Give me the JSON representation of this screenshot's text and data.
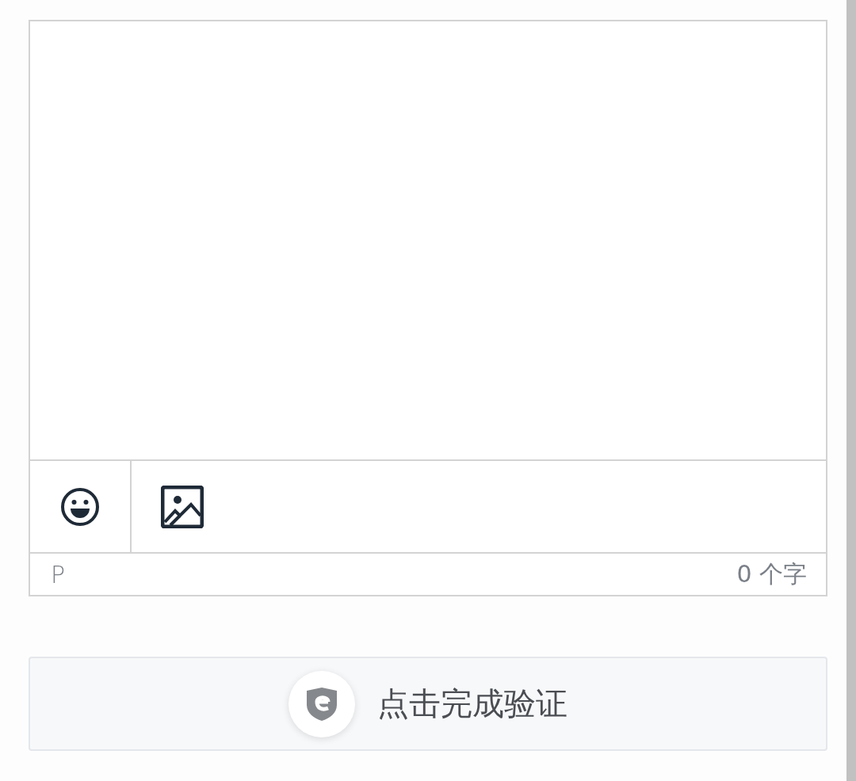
{
  "editor": {
    "path": "P",
    "word_count": "0 个字"
  },
  "captcha_button": {
    "label": "点击完成验证"
  }
}
